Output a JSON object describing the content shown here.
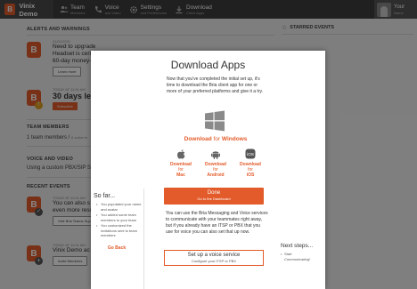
{
  "app": {
    "title": "Vinix Demo",
    "logo_letter": "B"
  },
  "nav": [
    {
      "label": "Team",
      "sub": "Members",
      "icon": "team-icon"
    },
    {
      "label": "Voice",
      "sub": "and Video",
      "icon": "voice-icon"
    },
    {
      "label": "Settings",
      "sub": "and Preferences",
      "icon": "gear-icon"
    },
    {
      "label": "Download",
      "sub": "Client Apps",
      "icon": "download-icon"
    }
  ],
  "user": {
    "name": "Your",
    "sub": "Name"
  },
  "background": {
    "alerts_title": "ALERTS AND WARNINGS",
    "alert1_date": "01/01/2021",
    "alert1_text1": "Need to upgrade",
    "alert1_text2": "Headset is certi",
    "alert1_text3": "60-day money-b",
    "alert1_btn": "Learn more",
    "alert2_date": "TODAY AT 11:01 AM",
    "alert2_text": "30 days left i",
    "alert2_btn": "Subscribe",
    "team_title": "TEAM MEMBERS",
    "team_text": "1 team members /",
    "team_small": "8 active te",
    "voice_title": "VOICE AND VIDEO",
    "voice_text": "Using a custom PBX/SIP Se",
    "recent_title": "RECENT EVENTS",
    "ev1_date": "TODAY AT 11:01 AM",
    "ev1_text1": "You can also s",
    "ev1_text2": "even more reso",
    "ev1_btn": "Visit Bria Teams Sup",
    "ev2_date": "TODAY AT 11:01 AM",
    "ev2_text": "Vinix Demo ac",
    "ev2_btn": "Invite Members",
    "starred_title": "STARRED EVENTS"
  },
  "modal": {
    "title": "Download Apps",
    "intro": "Now that you've completed the initial set up, it's time to download the Bria client app for one or more of your preferred platforms and give it a try.",
    "download_prefix": "Download",
    "download_for": "for",
    "windows_label": "Windows",
    "platforms": [
      {
        "line1": "Download",
        "line2": "for",
        "line3": "Mac",
        "icon": "apple-icon"
      },
      {
        "line1": "Download",
        "line2": "for",
        "line3": "Android",
        "icon": "android-icon"
      },
      {
        "line1": "Download",
        "line2": "for",
        "line3": "iOS",
        "icon": "ios-icon"
      }
    ],
    "done_label": "Done",
    "done_sub": "Go to the Dashboard",
    "below_text": "You can use the Bria Messaging and Voice services to communicate with your teammates right away, but if you already have an ITSP or PBX that you use for voice you can also set that up now.",
    "voice_btn_label": "Set up a voice service",
    "voice_btn_sub": "Configure your ITSP or PBX",
    "sofar_title": "So far...",
    "sofar_items": [
      "You populated your name and avatar",
      "You added some team members to your team",
      "You customized the invitations sent to team members"
    ],
    "go_back": "Go Back",
    "next_title": "Next steps...",
    "next_items": [
      "Start",
      "Communicating!"
    ]
  }
}
